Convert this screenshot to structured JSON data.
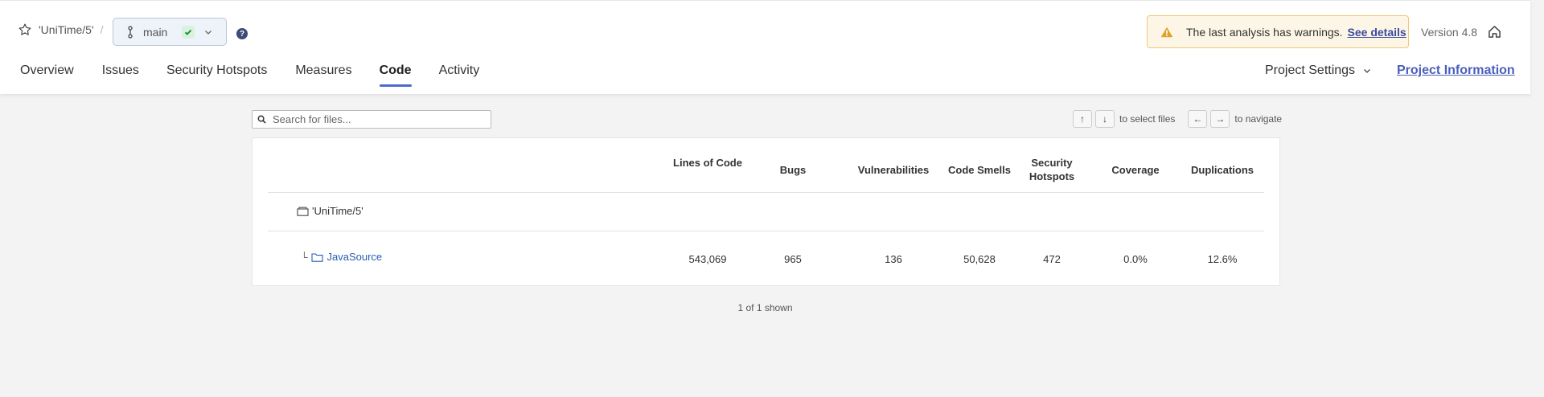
{
  "header": {
    "project_name": "'UniTime/5'",
    "separator": "/",
    "branch": "main",
    "help": "?",
    "warning": {
      "text": "The last analysis has warnings.",
      "link": "See details"
    },
    "version": "Version 4.8",
    "nav": [
      "Overview",
      "Issues",
      "Security Hotspots",
      "Measures",
      "Code",
      "Activity"
    ],
    "active_tab": "Code",
    "project_settings": "Project Settings",
    "project_information": "Project Information"
  },
  "search": {
    "placeholder": "Search for files..."
  },
  "hints": {
    "up": "↑",
    "down": "↓",
    "select_text": "to select files",
    "left": "←",
    "right": "→",
    "navigate_text": "to navigate"
  },
  "table": {
    "columns": [
      "Lines of Code",
      "Bugs",
      "Vulnerabilities",
      "Code Smells",
      "Security Hotspots",
      "Coverage",
      "Duplications"
    ],
    "root": "'UniTime/5'",
    "rows": [
      {
        "name": "JavaSource",
        "corner": "└",
        "values": [
          "543,069",
          "965",
          "136",
          "50,628",
          "472",
          "0.0%",
          "12.6%"
        ]
      }
    ]
  },
  "footer": {
    "shown": "1 of 1 shown"
  },
  "colors": {
    "accent": "#4b6bcf",
    "link": "#2a5db0",
    "warning_bg": "#fdf6e7",
    "success": "#00aa00"
  }
}
